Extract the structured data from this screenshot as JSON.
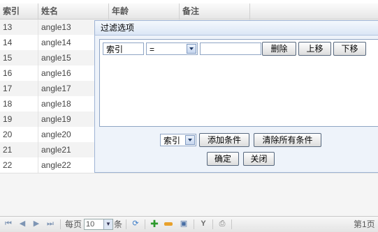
{
  "grid": {
    "columns": [
      "索引",
      "姓名",
      "年龄",
      "备注"
    ],
    "rows": [
      {
        "index": "13",
        "name": "angle13"
      },
      {
        "index": "14",
        "name": "angle14"
      },
      {
        "index": "15",
        "name": "angle15"
      },
      {
        "index": "16",
        "name": "angle16"
      },
      {
        "index": "17",
        "name": "angle17"
      },
      {
        "index": "18",
        "name": "angle18"
      },
      {
        "index": "19",
        "name": "angle19"
      },
      {
        "index": "20",
        "name": "angle20"
      },
      {
        "index": "21",
        "name": "angle21"
      },
      {
        "index": "22",
        "name": "angle22"
      }
    ]
  },
  "pager": {
    "per_page_label": "每页",
    "page_size": "10",
    "unit_label": "条",
    "page_info": "第1页",
    "icons": [
      "first-page-icon",
      "prev-page-icon",
      "next-page-icon",
      "last-page-icon",
      "refresh-icon",
      "add-icon",
      "remove-icon",
      "save-icon",
      "filter-icon",
      "print-icon"
    ]
  },
  "dialog": {
    "title": "过滤选项",
    "condition": {
      "field": "索引",
      "operator": "=",
      "value": "",
      "delete_label": "删除",
      "move_up_label": "上移",
      "move_down_label": "下移"
    },
    "field_select": "索引",
    "add_condition_label": "添加条件",
    "clear_all_label": "清除所有条件",
    "ok_label": "确定",
    "close_label": "关闭"
  }
}
